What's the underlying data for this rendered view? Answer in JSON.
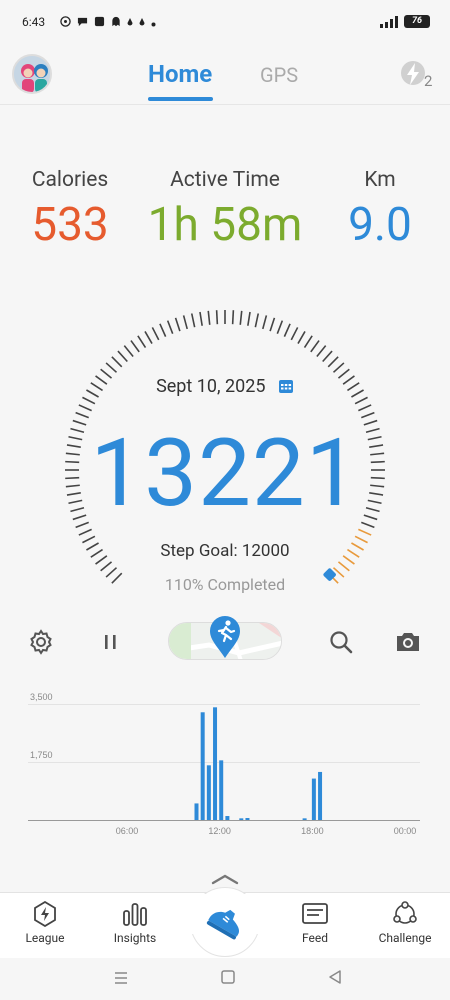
{
  "status_bar": {
    "time": "6:43",
    "battery": "76"
  },
  "tabs": {
    "home": "Home",
    "gps": "GPS"
  },
  "boost_count": "2",
  "stats": {
    "calories": {
      "label": "Calories",
      "value": "533"
    },
    "active_time": {
      "label": "Active Time",
      "value": "1h 58m"
    },
    "distance": {
      "label": "Km",
      "value": "9.0"
    }
  },
  "steps": {
    "date": "Sept 10, 2025",
    "count": "13221",
    "goal_text": "Step Goal: 12000",
    "completed_text": "110% Completed",
    "completion_fraction": 1.1
  },
  "chart_data": {
    "type": "bar",
    "y_ticks": [
      "3,500",
      "1,750"
    ],
    "x_ticks": [
      "06:00",
      "12:00",
      "18:00",
      "00:00"
    ],
    "ylim": [
      0,
      3500
    ],
    "grid": true,
    "bars": [
      {
        "hour": 10.5,
        "value": 500
      },
      {
        "hour": 10.9,
        "value": 3250
      },
      {
        "hour": 11.3,
        "value": 1650
      },
      {
        "hour": 11.7,
        "value": 3400
      },
      {
        "hour": 12.1,
        "value": 1800
      },
      {
        "hour": 12.5,
        "value": 120
      },
      {
        "hour": 13.4,
        "value": 50
      },
      {
        "hour": 13.8,
        "value": 60
      },
      {
        "hour": 17.5,
        "value": 50
      },
      {
        "hour": 18.1,
        "value": 1250
      },
      {
        "hour": 18.5,
        "value": 1450
      }
    ],
    "color": "#2e8ad8"
  },
  "nav": {
    "league": "League",
    "insights": "Insights",
    "feed": "Feed",
    "challenge": "Challenge"
  },
  "colors": {
    "accent": "#2e8ad8",
    "calories": "#e65b2e",
    "active": "#7cab2e",
    "goal_exceeded_ticks": "#e89a3c"
  }
}
